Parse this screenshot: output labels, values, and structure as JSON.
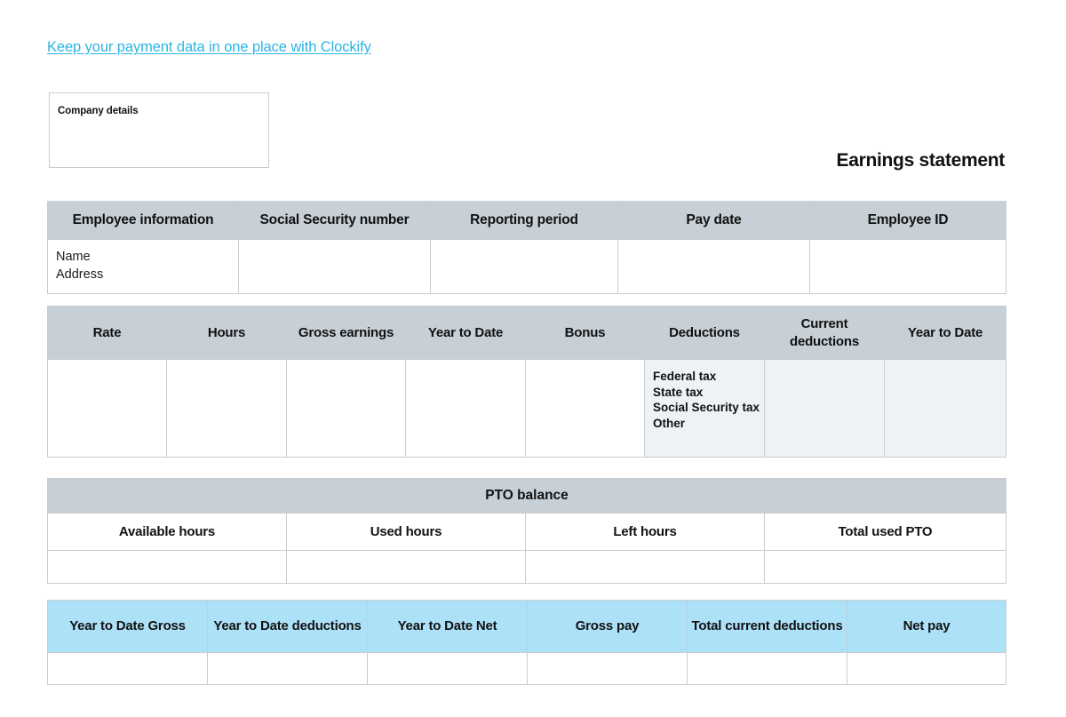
{
  "promo": {
    "link_text": "Keep your payment data in one place with Clockify",
    "link_color": "#2cb4e4"
  },
  "company_box": {
    "label": "Company details"
  },
  "document": {
    "title": "Earnings statement"
  },
  "colors": {
    "header_gray": "#c7d0d7",
    "header_blue": "#ade1f8",
    "cell_tint": "#edf2f5",
    "border": "#c9cdd1",
    "text": "#111111"
  },
  "employee_table": {
    "headers": [
      "Employee information",
      "Social Security number",
      "Reporting period",
      "Pay date",
      "Employee ID"
    ],
    "row": {
      "name_label": "Name",
      "address_label": "Address",
      "social_security_number": "",
      "reporting_period": "",
      "pay_date": "",
      "employee_id": ""
    }
  },
  "earnings_table": {
    "headers": [
      "Rate",
      "Hours",
      "Gross earnings",
      "Year to Date",
      "Bonus",
      "Deductions",
      "Current deductions",
      "Year to Date"
    ],
    "deduction_items": [
      "Federal tax",
      "State tax",
      "Social Security tax",
      "Other"
    ],
    "values": {
      "rate": "",
      "hours": "",
      "gross_earnings": "",
      "year_to_date": "",
      "bonus": "",
      "current_deductions": "",
      "year_to_date_deductions": ""
    }
  },
  "pto_table": {
    "title": "PTO balance",
    "headers": [
      "Available hours",
      "Used hours",
      "Left hours",
      "Total used PTO"
    ],
    "values": {
      "available_hours": "",
      "used_hours": "",
      "left_hours": "",
      "total_used_pto": ""
    }
  },
  "summary_table": {
    "headers": [
      "Year to Date Gross",
      "Year to Date deductions",
      "Year to Date Net",
      "Gross pay",
      "Total current deductions",
      "Net pay"
    ],
    "values": {
      "ytd_gross": "",
      "ytd_deductions": "",
      "ytd_net": "",
      "gross_pay": "",
      "total_current_deductions": "",
      "net_pay": ""
    }
  }
}
